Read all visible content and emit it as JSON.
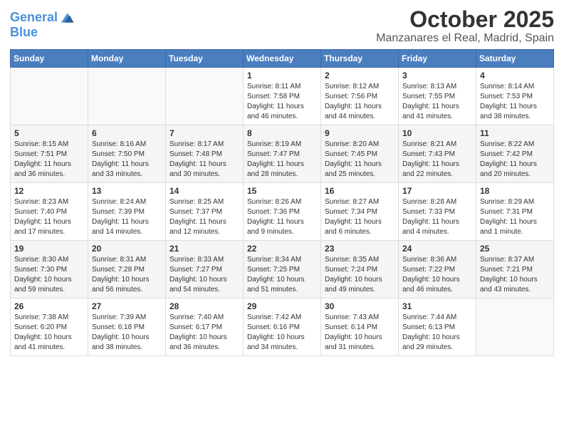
{
  "header": {
    "logo_line1": "General",
    "logo_line2": "Blue",
    "title": "October 2025",
    "subtitle": "Manzanares el Real, Madrid, Spain"
  },
  "weekdays": [
    "Sunday",
    "Monday",
    "Tuesday",
    "Wednesday",
    "Thursday",
    "Friday",
    "Saturday"
  ],
  "weeks": [
    [
      {
        "day": "",
        "sunrise": "",
        "sunset": "",
        "daylight": ""
      },
      {
        "day": "",
        "sunrise": "",
        "sunset": "",
        "daylight": ""
      },
      {
        "day": "",
        "sunrise": "",
        "sunset": "",
        "daylight": ""
      },
      {
        "day": "1",
        "sunrise": "Sunrise: 8:11 AM",
        "sunset": "Sunset: 7:58 PM",
        "daylight": "Daylight: 11 hours and 46 minutes."
      },
      {
        "day": "2",
        "sunrise": "Sunrise: 8:12 AM",
        "sunset": "Sunset: 7:56 PM",
        "daylight": "Daylight: 11 hours and 44 minutes."
      },
      {
        "day": "3",
        "sunrise": "Sunrise: 8:13 AM",
        "sunset": "Sunset: 7:55 PM",
        "daylight": "Daylight: 11 hours and 41 minutes."
      },
      {
        "day": "4",
        "sunrise": "Sunrise: 8:14 AM",
        "sunset": "Sunset: 7:53 PM",
        "daylight": "Daylight: 11 hours and 38 minutes."
      }
    ],
    [
      {
        "day": "5",
        "sunrise": "Sunrise: 8:15 AM",
        "sunset": "Sunset: 7:51 PM",
        "daylight": "Daylight: 11 hours and 36 minutes."
      },
      {
        "day": "6",
        "sunrise": "Sunrise: 8:16 AM",
        "sunset": "Sunset: 7:50 PM",
        "daylight": "Daylight: 11 hours and 33 minutes."
      },
      {
        "day": "7",
        "sunrise": "Sunrise: 8:17 AM",
        "sunset": "Sunset: 7:48 PM",
        "daylight": "Daylight: 11 hours and 30 minutes."
      },
      {
        "day": "8",
        "sunrise": "Sunrise: 8:19 AM",
        "sunset": "Sunset: 7:47 PM",
        "daylight": "Daylight: 11 hours and 28 minutes."
      },
      {
        "day": "9",
        "sunrise": "Sunrise: 8:20 AM",
        "sunset": "Sunset: 7:45 PM",
        "daylight": "Daylight: 11 hours and 25 minutes."
      },
      {
        "day": "10",
        "sunrise": "Sunrise: 8:21 AM",
        "sunset": "Sunset: 7:43 PM",
        "daylight": "Daylight: 11 hours and 22 minutes."
      },
      {
        "day": "11",
        "sunrise": "Sunrise: 8:22 AM",
        "sunset": "Sunset: 7:42 PM",
        "daylight": "Daylight: 11 hours and 20 minutes."
      }
    ],
    [
      {
        "day": "12",
        "sunrise": "Sunrise: 8:23 AM",
        "sunset": "Sunset: 7:40 PM",
        "daylight": "Daylight: 11 hours and 17 minutes."
      },
      {
        "day": "13",
        "sunrise": "Sunrise: 8:24 AM",
        "sunset": "Sunset: 7:39 PM",
        "daylight": "Daylight: 11 hours and 14 minutes."
      },
      {
        "day": "14",
        "sunrise": "Sunrise: 8:25 AM",
        "sunset": "Sunset: 7:37 PM",
        "daylight": "Daylight: 11 hours and 12 minutes."
      },
      {
        "day": "15",
        "sunrise": "Sunrise: 8:26 AM",
        "sunset": "Sunset: 7:36 PM",
        "daylight": "Daylight: 11 hours and 9 minutes."
      },
      {
        "day": "16",
        "sunrise": "Sunrise: 8:27 AM",
        "sunset": "Sunset: 7:34 PM",
        "daylight": "Daylight: 11 hours and 6 minutes."
      },
      {
        "day": "17",
        "sunrise": "Sunrise: 8:28 AM",
        "sunset": "Sunset: 7:33 PM",
        "daylight": "Daylight: 11 hours and 4 minutes."
      },
      {
        "day": "18",
        "sunrise": "Sunrise: 8:29 AM",
        "sunset": "Sunset: 7:31 PM",
        "daylight": "Daylight: 11 hours and 1 minute."
      }
    ],
    [
      {
        "day": "19",
        "sunrise": "Sunrise: 8:30 AM",
        "sunset": "Sunset: 7:30 PM",
        "daylight": "Daylight: 10 hours and 59 minutes."
      },
      {
        "day": "20",
        "sunrise": "Sunrise: 8:31 AM",
        "sunset": "Sunset: 7:28 PM",
        "daylight": "Daylight: 10 hours and 56 minutes."
      },
      {
        "day": "21",
        "sunrise": "Sunrise: 8:33 AM",
        "sunset": "Sunset: 7:27 PM",
        "daylight": "Daylight: 10 hours and 54 minutes."
      },
      {
        "day": "22",
        "sunrise": "Sunrise: 8:34 AM",
        "sunset": "Sunset: 7:25 PM",
        "daylight": "Daylight: 10 hours and 51 minutes."
      },
      {
        "day": "23",
        "sunrise": "Sunrise: 8:35 AM",
        "sunset": "Sunset: 7:24 PM",
        "daylight": "Daylight: 10 hours and 49 minutes."
      },
      {
        "day": "24",
        "sunrise": "Sunrise: 8:36 AM",
        "sunset": "Sunset: 7:22 PM",
        "daylight": "Daylight: 10 hours and 46 minutes."
      },
      {
        "day": "25",
        "sunrise": "Sunrise: 8:37 AM",
        "sunset": "Sunset: 7:21 PM",
        "daylight": "Daylight: 10 hours and 43 minutes."
      }
    ],
    [
      {
        "day": "26",
        "sunrise": "Sunrise: 7:38 AM",
        "sunset": "Sunset: 6:20 PM",
        "daylight": "Daylight: 10 hours and 41 minutes."
      },
      {
        "day": "27",
        "sunrise": "Sunrise: 7:39 AM",
        "sunset": "Sunset: 6:18 PM",
        "daylight": "Daylight: 10 hours and 38 minutes."
      },
      {
        "day": "28",
        "sunrise": "Sunrise: 7:40 AM",
        "sunset": "Sunset: 6:17 PM",
        "daylight": "Daylight: 10 hours and 36 minutes."
      },
      {
        "day": "29",
        "sunrise": "Sunrise: 7:42 AM",
        "sunset": "Sunset: 6:16 PM",
        "daylight": "Daylight: 10 hours and 34 minutes."
      },
      {
        "day": "30",
        "sunrise": "Sunrise: 7:43 AM",
        "sunset": "Sunset: 6:14 PM",
        "daylight": "Daylight: 10 hours and 31 minutes."
      },
      {
        "day": "31",
        "sunrise": "Sunrise: 7:44 AM",
        "sunset": "Sunset: 6:13 PM",
        "daylight": "Daylight: 10 hours and 29 minutes."
      },
      {
        "day": "",
        "sunrise": "",
        "sunset": "",
        "daylight": ""
      }
    ]
  ]
}
